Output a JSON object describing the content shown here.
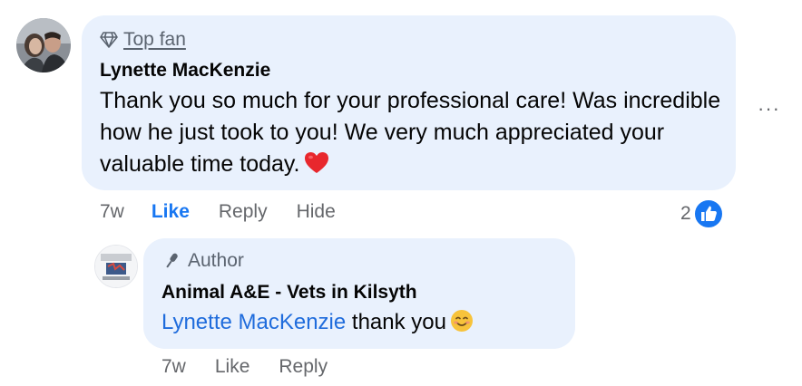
{
  "top_comment": {
    "badge_icon": "diamond-icon",
    "badge_label": "Top fan",
    "author": "Lynette MacKenzie",
    "text": "Thank you so much for your professional care! Was incredible how he just took to you! We very much appreciated your valuable time today.",
    "emoji_icon": "red-heart-emoji",
    "more_icon": "more-options-icon",
    "more_label": "···",
    "actions": {
      "time": "7w",
      "like": "Like",
      "reply": "Reply",
      "hide": "Hide"
    },
    "reaction_count": "2",
    "reaction_icon": "like-reaction-icon",
    "like_color": "#1877f2"
  },
  "reply": {
    "badge_icon": "microphone-icon",
    "badge_label": "Author",
    "author": "Animal A&E - Vets in Kilsyth",
    "mention": "Lynette MacKenzie",
    "text": "thank you",
    "emoji_icon": "smiling-face-emoji",
    "mention_color": "#1f6cdc",
    "actions": {
      "time": "7w",
      "like": "Like",
      "reply": "Reply"
    }
  },
  "colors": {
    "bubble_bg": "#e9f1fd",
    "secondary_text": "#65676b"
  }
}
